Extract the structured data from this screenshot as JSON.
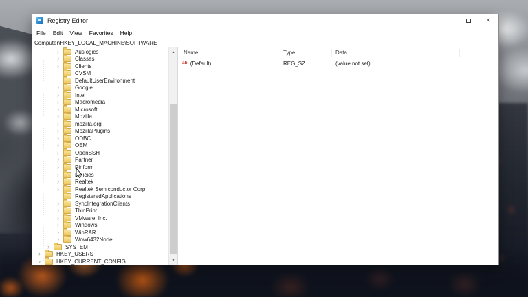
{
  "window": {
    "title": "Registry Editor",
    "menu_items": [
      "File",
      "Edit",
      "View",
      "Favorites",
      "Help"
    ],
    "address": "Computer\\HKEY_LOCAL_MACHINE\\SOFTWARE"
  },
  "icons": {
    "chevron": "›",
    "close": "✕",
    "scroll_up": "▲",
    "scroll_down": "▼"
  },
  "tree": {
    "items": [
      {
        "label": "Auslogics",
        "level": 3,
        "expandable": true
      },
      {
        "label": "Classes",
        "level": 3,
        "expandable": true
      },
      {
        "label": "Clients",
        "level": 3,
        "expandable": true
      },
      {
        "label": "CVSM",
        "level": 3,
        "expandable": false
      },
      {
        "label": "DefaultUserEnvironment",
        "level": 3,
        "expandable": false
      },
      {
        "label": "Google",
        "level": 3,
        "expandable": true
      },
      {
        "label": "Intel",
        "level": 3,
        "expandable": true
      },
      {
        "label": "Macromedia",
        "level": 3,
        "expandable": true
      },
      {
        "label": "Microsoft",
        "level": 3,
        "expandable": true
      },
      {
        "label": "Mozilla",
        "level": 3,
        "expandable": true
      },
      {
        "label": "mozilla.org",
        "level": 3,
        "expandable": true
      },
      {
        "label": "MozillaPlugins",
        "level": 3,
        "expandable": true
      },
      {
        "label": "ODBC",
        "level": 3,
        "expandable": true
      },
      {
        "label": "OEM",
        "level": 3,
        "expandable": true
      },
      {
        "label": "OpenSSH",
        "level": 3,
        "expandable": true
      },
      {
        "label": "Partner",
        "level": 3,
        "expandable": true
      },
      {
        "label": "Piriform",
        "level": 3,
        "expandable": true
      },
      {
        "label": "Policies",
        "level": 3,
        "expandable": true
      },
      {
        "label": "Realtek",
        "level": 3,
        "expandable": true
      },
      {
        "label": "Realtek Semiconductor Corp.",
        "level": 3,
        "expandable": true
      },
      {
        "label": "RegisteredApplications",
        "level": 3,
        "expandable": false
      },
      {
        "label": "SyncIntegrationClients",
        "level": 3,
        "expandable": true
      },
      {
        "label": "ThinPrint",
        "level": 3,
        "expandable": true
      },
      {
        "label": "VMware, Inc.",
        "level": 3,
        "expandable": true
      },
      {
        "label": "Windows",
        "level": 3,
        "expandable": true
      },
      {
        "label": "WinRAR",
        "level": 3,
        "expandable": true
      },
      {
        "label": "Wow6432Node",
        "level": 3,
        "expandable": true
      },
      {
        "label": "SYSTEM",
        "level": 2,
        "expandable": true
      },
      {
        "label": "HKEY_USERS",
        "level": 1,
        "expandable": true
      },
      {
        "label": "HKEY_CURRENT_CONFIG",
        "level": 1,
        "expandable": true
      }
    ]
  },
  "list": {
    "columns": [
      "Name",
      "Type",
      "Data"
    ],
    "rows": [
      {
        "icon": "string-value-icon",
        "icon_text": "ab",
        "name": "(Default)",
        "type": "REG_SZ",
        "data": "(value not set)"
      }
    ]
  },
  "colors": {
    "folder": "#eec75f",
    "folder_border": "#d6a94c",
    "string_value_icon": "#c23b2e",
    "titlebar_bg": "#ffffff",
    "window_border": "#8c8c8c",
    "scroll_thumb": "#cdcdcd"
  }
}
